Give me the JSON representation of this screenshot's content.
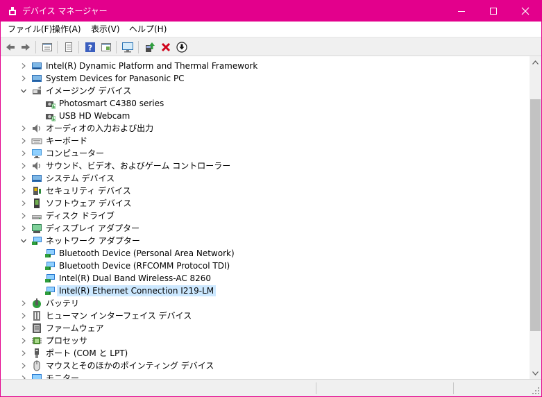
{
  "window": {
    "title": "デバイス マネージャー",
    "accent": "#e3008c"
  },
  "menubar": {
    "items": [
      "ファイル(F)",
      "操作(A)",
      "表示(V)",
      "ヘルプ(H)"
    ]
  },
  "toolbar": {
    "buttons": [
      "back-icon",
      "forward-icon",
      "properties-icon",
      "details-icon",
      "help-icon",
      "action-icon",
      "monitor-icon",
      "update-driver-icon",
      "uninstall-icon",
      "install-icon"
    ]
  },
  "tree": {
    "items": [
      {
        "label": "Intel(R) Dynamic Platform and Thermal Framework",
        "level": 0,
        "state": "collapsed",
        "icon": "system-icon"
      },
      {
        "label": "System Devices for Panasonic PC",
        "level": 0,
        "state": "collapsed",
        "icon": "system-icon"
      },
      {
        "label": "イメージング デバイス",
        "level": 0,
        "state": "expanded",
        "icon": "imaging-icon"
      },
      {
        "label": "Photosmart C4380 series",
        "level": 1,
        "state": "none",
        "icon": "camera-icon"
      },
      {
        "label": "USB HD Webcam",
        "level": 1,
        "state": "none",
        "icon": "camera-icon"
      },
      {
        "label": "オーディオの入力および出力",
        "level": 0,
        "state": "collapsed",
        "icon": "audio-icon"
      },
      {
        "label": "キーボード",
        "level": 0,
        "state": "collapsed",
        "icon": "keyboard-icon"
      },
      {
        "label": "コンピューター",
        "level": 0,
        "state": "collapsed",
        "icon": "computer-icon"
      },
      {
        "label": "サウンド、ビデオ、およびゲーム コントローラー",
        "level": 0,
        "state": "collapsed",
        "icon": "audio-icon"
      },
      {
        "label": "システム デバイス",
        "level": 0,
        "state": "collapsed",
        "icon": "system-icon"
      },
      {
        "label": "セキュリティ デバイス",
        "level": 0,
        "state": "collapsed",
        "icon": "security-icon"
      },
      {
        "label": "ソフトウェア デバイス",
        "level": 0,
        "state": "collapsed",
        "icon": "software-device-icon"
      },
      {
        "label": "ディスク ドライブ",
        "level": 0,
        "state": "collapsed",
        "icon": "disk-icon"
      },
      {
        "label": "ディスプレイ アダプター",
        "level": 0,
        "state": "collapsed",
        "icon": "display-adapter-icon"
      },
      {
        "label": "ネットワーク アダプター",
        "level": 0,
        "state": "expanded",
        "icon": "network-icon"
      },
      {
        "label": "Bluetooth Device (Personal Area Network)",
        "level": 1,
        "state": "none",
        "icon": "network-icon"
      },
      {
        "label": "Bluetooth Device (RFCOMM Protocol TDI)",
        "level": 1,
        "state": "none",
        "icon": "network-icon"
      },
      {
        "label": "Intel(R) Dual Band Wireless-AC 8260",
        "level": 1,
        "state": "none",
        "icon": "network-icon"
      },
      {
        "label": "Intel(R) Ethernet Connection I219-LM",
        "level": 1,
        "state": "none",
        "icon": "network-icon",
        "selected": true
      },
      {
        "label": "バッテリ",
        "level": 0,
        "state": "collapsed",
        "icon": "battery-icon"
      },
      {
        "label": "ヒューマン インターフェイス デバイス",
        "level": 0,
        "state": "collapsed",
        "icon": "hid-icon"
      },
      {
        "label": "ファームウェア",
        "level": 0,
        "state": "collapsed",
        "icon": "firmware-icon"
      },
      {
        "label": "プロセッサ",
        "level": 0,
        "state": "collapsed",
        "icon": "processor-icon"
      },
      {
        "label": "ポート (COM と LPT)",
        "level": 0,
        "state": "collapsed",
        "icon": "port-icon"
      },
      {
        "label": "マウスとそのほかのポインティング デバイス",
        "level": 0,
        "state": "collapsed",
        "icon": "mouse-icon"
      },
      {
        "label": "モニター",
        "level": 0,
        "state": "collapsed",
        "icon": "monitor-icon"
      }
    ]
  }
}
